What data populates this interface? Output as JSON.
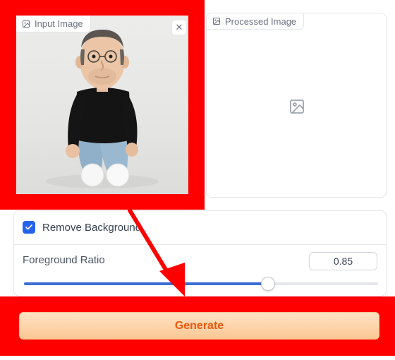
{
  "input_panel": {
    "label": "Input Image",
    "close_glyph": "✕",
    "label_icon": "image-icon",
    "close_icon": "close-icon"
  },
  "processed_panel": {
    "label": "Processed Image",
    "label_icon": "image-icon",
    "placeholder_icon": "image-icon"
  },
  "options": {
    "remove_background": {
      "label": "Remove Background",
      "checked": true
    },
    "foreground_ratio": {
      "label": "Foreground Ratio",
      "value": "0.85",
      "fraction": 0.69
    }
  },
  "generate": {
    "label": "Generate"
  },
  "colors": {
    "highlight": "#ff0000",
    "accent": "#2563eb",
    "slider_fill": "#3b6fd4",
    "button_text": "#ea580c",
    "button_bg_top": "#ffe2c4",
    "button_bg_bottom": "#fcc894"
  }
}
